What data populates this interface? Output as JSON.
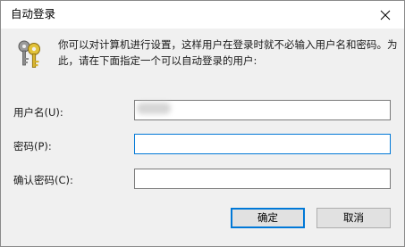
{
  "window": {
    "title": "自动登录",
    "close_glyph": "✕"
  },
  "description": "你可以对计算机进行设置，这样用户在登录时就不必输入用户名和密码。为此，请在下面指定一个可以自动登录的用户:",
  "form": {
    "username_label": "用户名(U):",
    "username_value": "",
    "password_label": "密码(P):",
    "password_value": "",
    "confirm_label": "确认密码(C):",
    "confirm_value": ""
  },
  "buttons": {
    "ok_label": "确定",
    "cancel_label": "取消"
  },
  "icons": {
    "main": "keys-icon",
    "close": "close-icon"
  },
  "colors": {
    "accent": "#0078d7",
    "panel": "#f0f0f0",
    "key_gold": "#d8b52f",
    "key_gray": "#8c8c8c"
  }
}
